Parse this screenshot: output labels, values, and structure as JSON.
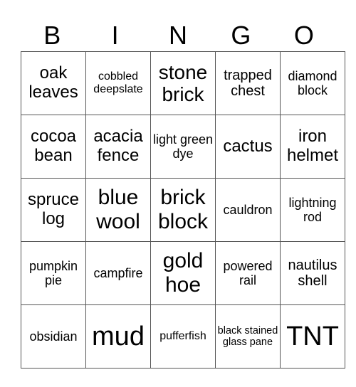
{
  "header": [
    "B",
    "I",
    "N",
    "G",
    "O"
  ],
  "cells": [
    [
      "oak leaves",
      "cobbled deepslate",
      "stone brick",
      "trapped chest",
      "diamond block"
    ],
    [
      "cocoa bean",
      "acacia fence",
      "light green dye",
      "cactus",
      "iron helmet"
    ],
    [
      "spruce log",
      "blue wool",
      "brick block",
      "cauldron",
      "lightning rod"
    ],
    [
      "pumpkin pie",
      "campfire",
      "gold hoe",
      "powered rail",
      "nautilus shell"
    ],
    [
      "obsidian",
      "mud",
      "pufferfish",
      "black stained glass pane",
      "TNT"
    ]
  ]
}
